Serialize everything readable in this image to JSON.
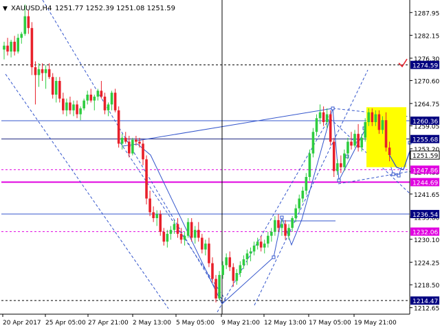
{
  "header": {
    "arrow": "▼",
    "symbol": "XAUUSD,H4",
    "ohlc": "1251.77 1252.39 1251.08 1251.59"
  },
  "colors": {
    "bull": "#2ecc40",
    "bear": "#e8202a",
    "blue_lines": "#3355cc",
    "magenta": "#e000e0",
    "forecast_box": "#ffff00",
    "axis": "#000000",
    "label_bg": "#000080"
  },
  "chart_data": {
    "type": "candlestick",
    "instrument": "XAUUSD",
    "timeframe": "H4",
    "ylim": [
      1210.0,
      1293.0
    ],
    "x_ticks": [
      "20 Apr 2017",
      "25 Apr 05:00",
      "27 Apr 21:00",
      "2 May 13:00",
      "5 May 05:00",
      "9 May 21:00",
      "12 May 13:00",
      "17 May 05:00",
      "19 May 21:00"
    ],
    "y_ticks": [
      1287.95,
      1282.15,
      1276.3,
      1270.6,
      1264.75,
      1259.05,
      1253.2,
      1247.35,
      1241.65,
      1235.8,
      1230.1,
      1224.25,
      1218.5,
      1212.65
    ],
    "price_labels": [
      {
        "text": "1274.59",
        "value": 1274.59,
        "style": "highlight"
      },
      {
        "text": "1260.36",
        "value": 1260.36,
        "style": "highlight"
      },
      {
        "text": "1255.68",
        "value": 1255.68,
        "style": "highlight"
      },
      {
        "text": "1251.59",
        "value": 1251.59,
        "style": "current"
      },
      {
        "text": "1247.86",
        "value": 1247.86,
        "style": "magenta"
      },
      {
        "text": "1244.69",
        "value": 1244.69,
        "style": "magenta-solid"
      },
      {
        "text": "1236.54",
        "value": 1236.54,
        "style": "highlight"
      },
      {
        "text": "1232.06",
        "value": 1232.06,
        "style": "magenta"
      },
      {
        "text": "1214.47",
        "value": 1214.47,
        "style": "highlight"
      }
    ],
    "levels": [
      {
        "value": 1274.59,
        "style": "black-dashed"
      },
      {
        "value": 1260.36,
        "style": "blue-solid"
      },
      {
        "value": 1255.68,
        "style": "navy-solid"
      },
      {
        "value": 1247.86,
        "style": "magenta-dashed"
      },
      {
        "value": 1244.69,
        "style": "magenta-solid"
      },
      {
        "value": 1236.54,
        "style": "blue-solid"
      },
      {
        "value": 1232.06,
        "style": "magenta-dashed"
      },
      {
        "value": 1214.47,
        "style": "black-dashed"
      }
    ],
    "candles": [
      {
        "o": 1278.5,
        "h": 1280.5,
        "l": 1276.0,
        "c": 1279.5
      },
      {
        "o": 1279.5,
        "h": 1281.5,
        "l": 1277.0,
        "c": 1278.0
      },
      {
        "o": 1278.0,
        "h": 1281.0,
        "l": 1276.5,
        "c": 1280.5
      },
      {
        "o": 1280.5,
        "h": 1282.0,
        "l": 1277.0,
        "c": 1278.0
      },
      {
        "o": 1278.0,
        "h": 1282.5,
        "l": 1277.5,
        "c": 1281.5
      },
      {
        "o": 1281.5,
        "h": 1283.0,
        "l": 1280.0,
        "c": 1282.5
      },
      {
        "o": 1282.5,
        "h": 1290.0,
        "l": 1282.0,
        "c": 1287.0
      },
      {
        "o": 1287.0,
        "h": 1288.5,
        "l": 1282.5,
        "c": 1284.0
      },
      {
        "o": 1284.0,
        "h": 1285.5,
        "l": 1272.0,
        "c": 1274.0
      },
      {
        "o": 1274.0,
        "h": 1275.5,
        "l": 1264.5,
        "c": 1272.0
      },
      {
        "o": 1272.0,
        "h": 1275.0,
        "l": 1269.0,
        "c": 1273.5
      },
      {
        "o": 1273.5,
        "h": 1275.0,
        "l": 1270.5,
        "c": 1272.5
      },
      {
        "o": 1272.5,
        "h": 1274.5,
        "l": 1268.5,
        "c": 1273.5
      },
      {
        "o": 1273.5,
        "h": 1275.0,
        "l": 1271.0,
        "c": 1271.5
      },
      {
        "o": 1271.5,
        "h": 1272.5,
        "l": 1266.0,
        "c": 1267.0
      },
      {
        "o": 1267.0,
        "h": 1271.5,
        "l": 1265.0,
        "c": 1270.5
      },
      {
        "o": 1270.5,
        "h": 1271.5,
        "l": 1265.0,
        "c": 1266.0
      },
      {
        "o": 1266.0,
        "h": 1267.5,
        "l": 1262.0,
        "c": 1263.0
      },
      {
        "o": 1263.0,
        "h": 1266.0,
        "l": 1261.5,
        "c": 1265.0
      },
      {
        "o": 1265.0,
        "h": 1266.5,
        "l": 1262.0,
        "c": 1263.0
      },
      {
        "o": 1263.0,
        "h": 1265.5,
        "l": 1261.5,
        "c": 1264.5
      },
      {
        "o": 1264.5,
        "h": 1265.5,
        "l": 1261.0,
        "c": 1262.0
      },
      {
        "o": 1262.0,
        "h": 1264.0,
        "l": 1260.5,
        "c": 1263.5
      },
      {
        "o": 1263.5,
        "h": 1266.0,
        "l": 1263.0,
        "c": 1265.5
      },
      {
        "o": 1265.5,
        "h": 1268.0,
        "l": 1264.5,
        "c": 1267.0
      },
      {
        "o": 1267.0,
        "h": 1268.5,
        "l": 1265.0,
        "c": 1265.5
      },
      {
        "o": 1265.5,
        "h": 1267.0,
        "l": 1263.0,
        "c": 1266.5
      },
      {
        "o": 1266.5,
        "h": 1268.5,
        "l": 1265.5,
        "c": 1268.0
      },
      {
        "o": 1268.0,
        "h": 1270.5,
        "l": 1266.0,
        "c": 1266.5
      },
      {
        "o": 1266.5,
        "h": 1267.5,
        "l": 1262.0,
        "c": 1263.0
      },
      {
        "o": 1263.0,
        "h": 1265.0,
        "l": 1261.5,
        "c": 1264.5
      },
      {
        "o": 1264.5,
        "h": 1268.0,
        "l": 1263.0,
        "c": 1267.5
      },
      {
        "o": 1267.5,
        "h": 1268.5,
        "l": 1262.5,
        "c": 1263.0
      },
      {
        "o": 1263.0,
        "h": 1264.0,
        "l": 1253.5,
        "c": 1254.5
      },
      {
        "o": 1254.5,
        "h": 1257.0,
        "l": 1253.0,
        "c": 1256.0
      },
      {
        "o": 1256.0,
        "h": 1257.5,
        "l": 1254.5,
        "c": 1255.0
      },
      {
        "o": 1255.0,
        "h": 1256.5,
        "l": 1251.0,
        "c": 1252.0
      },
      {
        "o": 1252.0,
        "h": 1256.0,
        "l": 1251.5,
        "c": 1255.5
      },
      {
        "o": 1255.5,
        "h": 1256.5,
        "l": 1254.0,
        "c": 1255.0
      },
      {
        "o": 1255.0,
        "h": 1256.0,
        "l": 1253.5,
        "c": 1254.5
      },
      {
        "o": 1254.5,
        "h": 1255.5,
        "l": 1249.0,
        "c": 1250.5
      },
      {
        "o": 1250.5,
        "h": 1251.5,
        "l": 1239.0,
        "c": 1240.5
      },
      {
        "o": 1240.5,
        "h": 1242.5,
        "l": 1236.0,
        "c": 1237.0
      },
      {
        "o": 1237.0,
        "h": 1238.5,
        "l": 1234.5,
        "c": 1235.5
      },
      {
        "o": 1235.5,
        "h": 1237.5,
        "l": 1233.5,
        "c": 1236.5
      },
      {
        "o": 1236.5,
        "h": 1237.5,
        "l": 1231.0,
        "c": 1232.0
      },
      {
        "o": 1232.0,
        "h": 1233.0,
        "l": 1228.5,
        "c": 1229.5
      },
      {
        "o": 1229.5,
        "h": 1232.5,
        "l": 1228.0,
        "c": 1231.5
      },
      {
        "o": 1231.5,
        "h": 1233.5,
        "l": 1230.0,
        "c": 1232.5
      },
      {
        "o": 1232.5,
        "h": 1235.0,
        "l": 1231.5,
        "c": 1234.0
      },
      {
        "o": 1234.0,
        "h": 1235.5,
        "l": 1230.5,
        "c": 1231.5
      },
      {
        "o": 1231.5,
        "h": 1233.0,
        "l": 1229.0,
        "c": 1230.0
      },
      {
        "o": 1230.0,
        "h": 1232.0,
        "l": 1228.5,
        "c": 1231.0
      },
      {
        "o": 1231.0,
        "h": 1235.5,
        "l": 1230.5,
        "c": 1234.5
      },
      {
        "o": 1234.5,
        "h": 1235.5,
        "l": 1229.5,
        "c": 1230.5
      },
      {
        "o": 1230.5,
        "h": 1233.5,
        "l": 1229.0,
        "c": 1232.5
      },
      {
        "o": 1232.5,
        "h": 1234.5,
        "l": 1229.5,
        "c": 1230.5
      },
      {
        "o": 1230.5,
        "h": 1231.5,
        "l": 1226.5,
        "c": 1227.5
      },
      {
        "o": 1227.5,
        "h": 1230.0,
        "l": 1226.0,
        "c": 1229.0
      },
      {
        "o": 1229.0,
        "h": 1230.5,
        "l": 1223.0,
        "c": 1224.0
      },
      {
        "o": 1224.0,
        "h": 1225.5,
        "l": 1219.0,
        "c": 1220.0
      },
      {
        "o": 1220.0,
        "h": 1221.0,
        "l": 1214.0,
        "c": 1215.0
      },
      {
        "o": 1215.0,
        "h": 1222.0,
        "l": 1214.5,
        "c": 1221.0
      },
      {
        "o": 1221.0,
        "h": 1224.5,
        "l": 1220.0,
        "c": 1223.5
      },
      {
        "o": 1223.5,
        "h": 1226.5,
        "l": 1222.5,
        "c": 1225.5
      },
      {
        "o": 1225.5,
        "h": 1227.0,
        "l": 1222.0,
        "c": 1223.0
      },
      {
        "o": 1223.0,
        "h": 1224.0,
        "l": 1218.0,
        "c": 1219.5
      },
      {
        "o": 1219.5,
        "h": 1222.5,
        "l": 1218.5,
        "c": 1221.5
      },
      {
        "o": 1221.5,
        "h": 1224.5,
        "l": 1220.5,
        "c": 1223.5
      },
      {
        "o": 1223.5,
        "h": 1226.0,
        "l": 1222.5,
        "c": 1225.0
      },
      {
        "o": 1225.0,
        "h": 1227.5,
        "l": 1223.5,
        "c": 1226.5
      },
      {
        "o": 1226.5,
        "h": 1228.0,
        "l": 1224.5,
        "c": 1227.0
      },
      {
        "o": 1227.0,
        "h": 1229.5,
        "l": 1226.0,
        "c": 1228.5
      },
      {
        "o": 1228.5,
        "h": 1230.5,
        "l": 1227.5,
        "c": 1229.5
      },
      {
        "o": 1229.5,
        "h": 1231.0,
        "l": 1227.0,
        "c": 1228.0
      },
      {
        "o": 1228.0,
        "h": 1230.0,
        "l": 1226.5,
        "c": 1229.0
      },
      {
        "o": 1229.0,
        "h": 1232.0,
        "l": 1228.0,
        "c": 1231.0
      },
      {
        "o": 1231.0,
        "h": 1233.0,
        "l": 1229.5,
        "c": 1232.0
      },
      {
        "o": 1232.0,
        "h": 1236.0,
        "l": 1231.0,
        "c": 1235.0
      },
      {
        "o": 1235.0,
        "h": 1236.5,
        "l": 1232.0,
        "c": 1233.0
      },
      {
        "o": 1233.0,
        "h": 1235.0,
        "l": 1231.0,
        "c": 1234.0
      },
      {
        "o": 1234.0,
        "h": 1235.0,
        "l": 1230.0,
        "c": 1231.0
      },
      {
        "o": 1231.0,
        "h": 1234.0,
        "l": 1230.0,
        "c": 1233.0
      },
      {
        "o": 1233.0,
        "h": 1236.0,
        "l": 1232.0,
        "c": 1235.5
      },
      {
        "o": 1235.5,
        "h": 1239.0,
        "l": 1234.5,
        "c": 1238.0
      },
      {
        "o": 1238.0,
        "h": 1241.5,
        "l": 1237.0,
        "c": 1240.5
      },
      {
        "o": 1240.5,
        "h": 1243.5,
        "l": 1239.5,
        "c": 1242.5
      },
      {
        "o": 1242.5,
        "h": 1247.0,
        "l": 1241.5,
        "c": 1246.0
      },
      {
        "o": 1246.0,
        "h": 1253.0,
        "l": 1245.0,
        "c": 1252.0
      },
      {
        "o": 1252.0,
        "h": 1258.5,
        "l": 1251.0,
        "c": 1257.5
      },
      {
        "o": 1257.5,
        "h": 1262.0,
        "l": 1256.5,
        "c": 1261.0
      },
      {
        "o": 1261.0,
        "h": 1264.5,
        "l": 1259.5,
        "c": 1262.5
      },
      {
        "o": 1262.5,
        "h": 1264.0,
        "l": 1259.0,
        "c": 1260.0
      },
      {
        "o": 1260.0,
        "h": 1263.5,
        "l": 1258.5,
        "c": 1262.0
      },
      {
        "o": 1262.0,
        "h": 1263.0,
        "l": 1254.0,
        "c": 1255.0
      },
      {
        "o": 1255.0,
        "h": 1256.0,
        "l": 1246.0,
        "c": 1247.5
      },
      {
        "o": 1247.5,
        "h": 1250.5,
        "l": 1246.5,
        "c": 1249.5
      },
      {
        "o": 1249.5,
        "h": 1251.5,
        "l": 1247.0,
        "c": 1248.5
      },
      {
        "o": 1248.5,
        "h": 1253.0,
        "l": 1247.5,
        "c": 1252.0
      },
      {
        "o": 1252.0,
        "h": 1256.0,
        "l": 1250.5,
        "c": 1255.0
      },
      {
        "o": 1255.0,
        "h": 1257.5,
        "l": 1253.0,
        "c": 1254.0
      },
      {
        "o": 1254.0,
        "h": 1258.0,
        "l": 1253.5,
        "c": 1257.0
      },
      {
        "o": 1257.0,
        "h": 1259.5,
        "l": 1252.5,
        "c": 1253.5
      },
      {
        "o": 1253.5,
        "h": 1257.0,
        "l": 1252.5,
        "c": 1256.0
      },
      {
        "o": 1256.0,
        "h": 1261.0,
        "l": 1255.0,
        "c": 1260.0
      },
      {
        "o": 1260.0,
        "h": 1263.5,
        "l": 1259.0,
        "c": 1262.5
      },
      {
        "o": 1262.5,
        "h": 1263.5,
        "l": 1259.0,
        "c": 1260.0
      },
      {
        "o": 1260.0,
        "h": 1263.0,
        "l": 1259.0,
        "c": 1262.0
      },
      {
        "o": 1262.0,
        "h": 1263.0,
        "l": 1257.0,
        "c": 1258.0
      },
      {
        "o": 1258.0,
        "h": 1261.5,
        "l": 1257.0,
        "c": 1260.5
      },
      {
        "o": 1260.5,
        "h": 1262.5,
        "l": 1252.5,
        "c": 1253.5
      },
      {
        "o": 1253.5,
        "h": 1255.0,
        "l": 1250.0,
        "c": 1251.6
      }
    ],
    "forecast_path": [
      {
        "i": 111,
        "p": 1251.59
      },
      {
        "i": 113,
        "p": 1248.5
      },
      {
        "i": 115,
        "p": 1247.86
      },
      {
        "i": 117,
        "p": 1253.0
      }
    ]
  }
}
